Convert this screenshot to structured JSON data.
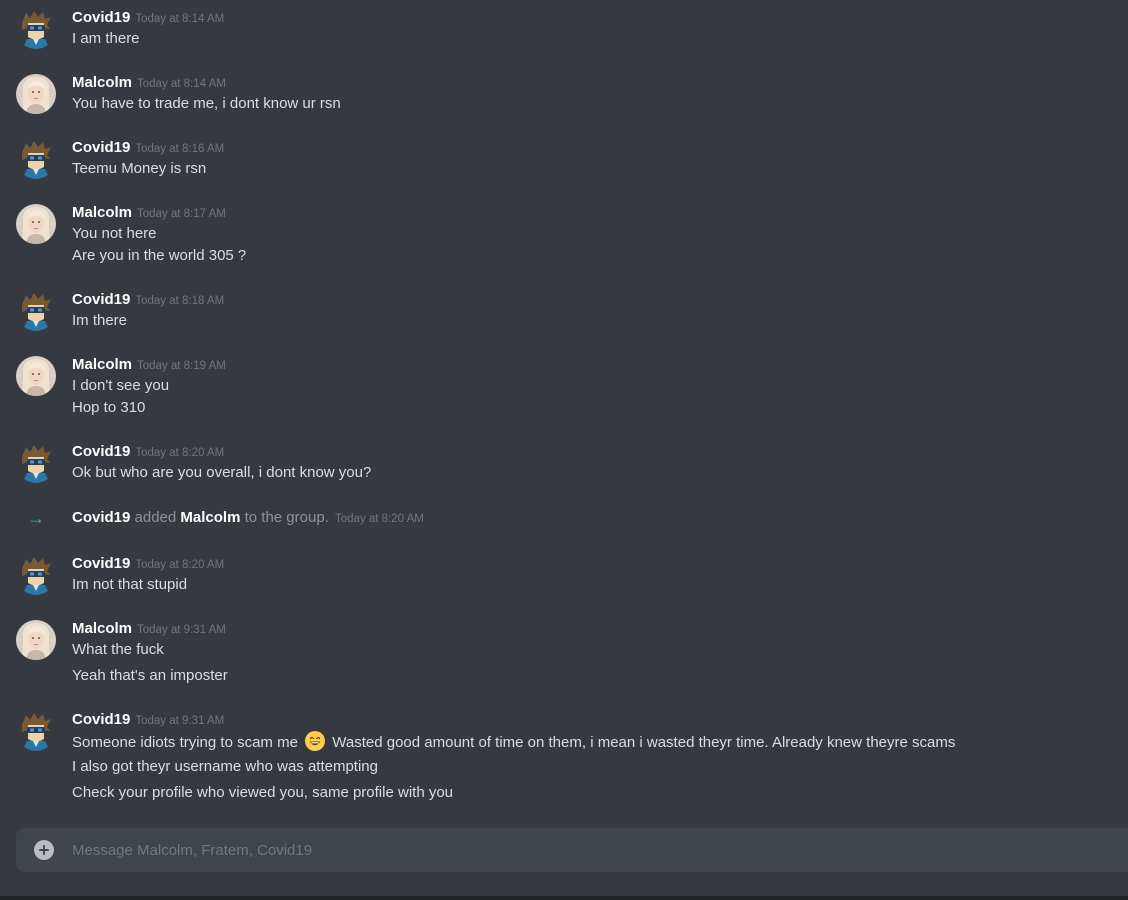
{
  "users": {
    "covid": "Covid19",
    "malcolm": "Malcolm"
  },
  "colors": {
    "background": "#36393f",
    "author": "#ffffff",
    "text": "#dcddde",
    "timestamp": "#72767d",
    "system_arrow": "#43b581",
    "composer": "#40444b"
  },
  "messages": [
    {
      "author": "Covid19",
      "time": "Today at 8:14 AM",
      "lines": [
        "I am there"
      ]
    },
    {
      "author": "Malcolm",
      "time": "Today at 8:14 AM",
      "lines": [
        "You have to trade me, i dont know ur rsn"
      ]
    },
    {
      "author": "Covid19",
      "time": "Today at 8:16 AM",
      "lines": [
        "Teemu Money is rsn"
      ]
    },
    {
      "author": "Malcolm",
      "time": "Today at 8:17 AM",
      "lines": [
        "You not here",
        "Are you in the world 305 ?"
      ]
    },
    {
      "author": "Covid19",
      "time": "Today at 8:18 AM",
      "lines": [
        "Im there"
      ]
    },
    {
      "author": "Malcolm",
      "time": "Today at 8:19 AM",
      "lines": [
        "I don't see you",
        "Hop to 310"
      ]
    },
    {
      "author": "Covid19",
      "time": "Today at 8:20 AM",
      "lines": [
        "Ok but who are you overall, i dont know you?"
      ]
    },
    {
      "author": "Covid19",
      "time": "Today at 8:20 AM",
      "lines": [
        "Im not that stupid"
      ]
    },
    {
      "author": "Malcolm",
      "time": "Today at 9:31 AM",
      "lines": [
        "What the fuck",
        "Yeah that's an imposter"
      ]
    },
    {
      "author": "Covid19",
      "time": "Today at 9:31 AM",
      "lines": [
        "Someone idiots trying to scam me",
        "Wasted good amount of time on them, i mean i wasted theyr time. Already knew theyre scams",
        "I also got theyr username who was attempting",
        "Check your profile who viewed you, same profile with you"
      ]
    }
  ],
  "system": {
    "actor": "Covid19",
    "verb": "added",
    "target": "Malcolm",
    "suffix": "to the group.",
    "time": "Today at 8:20 AM",
    "icon": "arrow-right-icon"
  },
  "emoji": {
    "name": "grinning-face-icon"
  },
  "composer": {
    "placeholder": "Message Malcolm, Fratem, Covid19",
    "value": "",
    "attach_icon": "plus-circle-icon"
  }
}
